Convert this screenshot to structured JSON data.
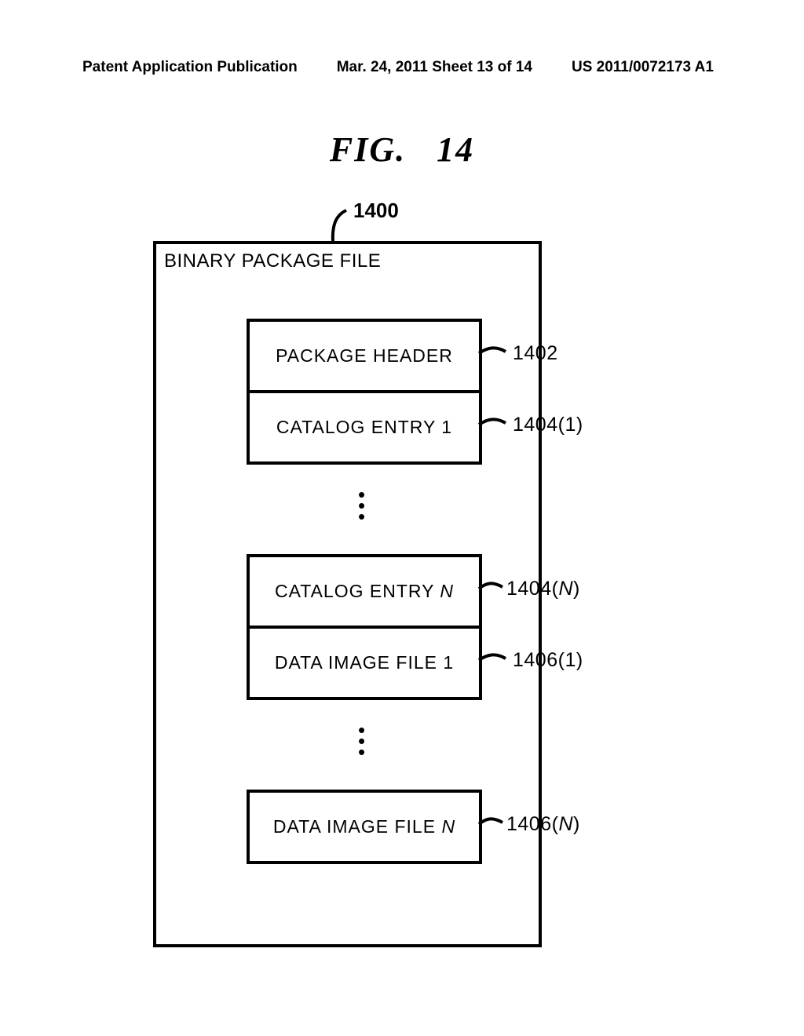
{
  "header": {
    "left": "Patent Application Publication",
    "center": "Mar. 24, 2011  Sheet 13 of 14",
    "right": "US 2011/0072173 A1"
  },
  "figure": {
    "title_prefix": "FIG.",
    "title_number": "14",
    "outer_ref": "1400",
    "outer_title": "BINARY PACKAGE FILE",
    "blocks": {
      "package_header": "PACKAGE HEADER",
      "catalog_entry_1": "CATALOG ENTRY 1",
      "catalog_entry_n_prefix": "CATALOG ENTRY ",
      "catalog_entry_n_suffix": "N",
      "data_image_1": "DATA IMAGE FILE 1",
      "data_image_n_prefix": "DATA IMAGE FILE ",
      "data_image_n_suffix": "N"
    },
    "refs": {
      "r1402": "1402",
      "r1404_1": "1404(1)",
      "r1404_n_prefix": "1404(",
      "r1404_n_mid": "N",
      "r1404_n_suffix": ")",
      "r1406_1": "1406(1)",
      "r1406_n_prefix": "1406(",
      "r1406_n_mid": "N",
      "r1406_n_suffix": ")"
    }
  }
}
